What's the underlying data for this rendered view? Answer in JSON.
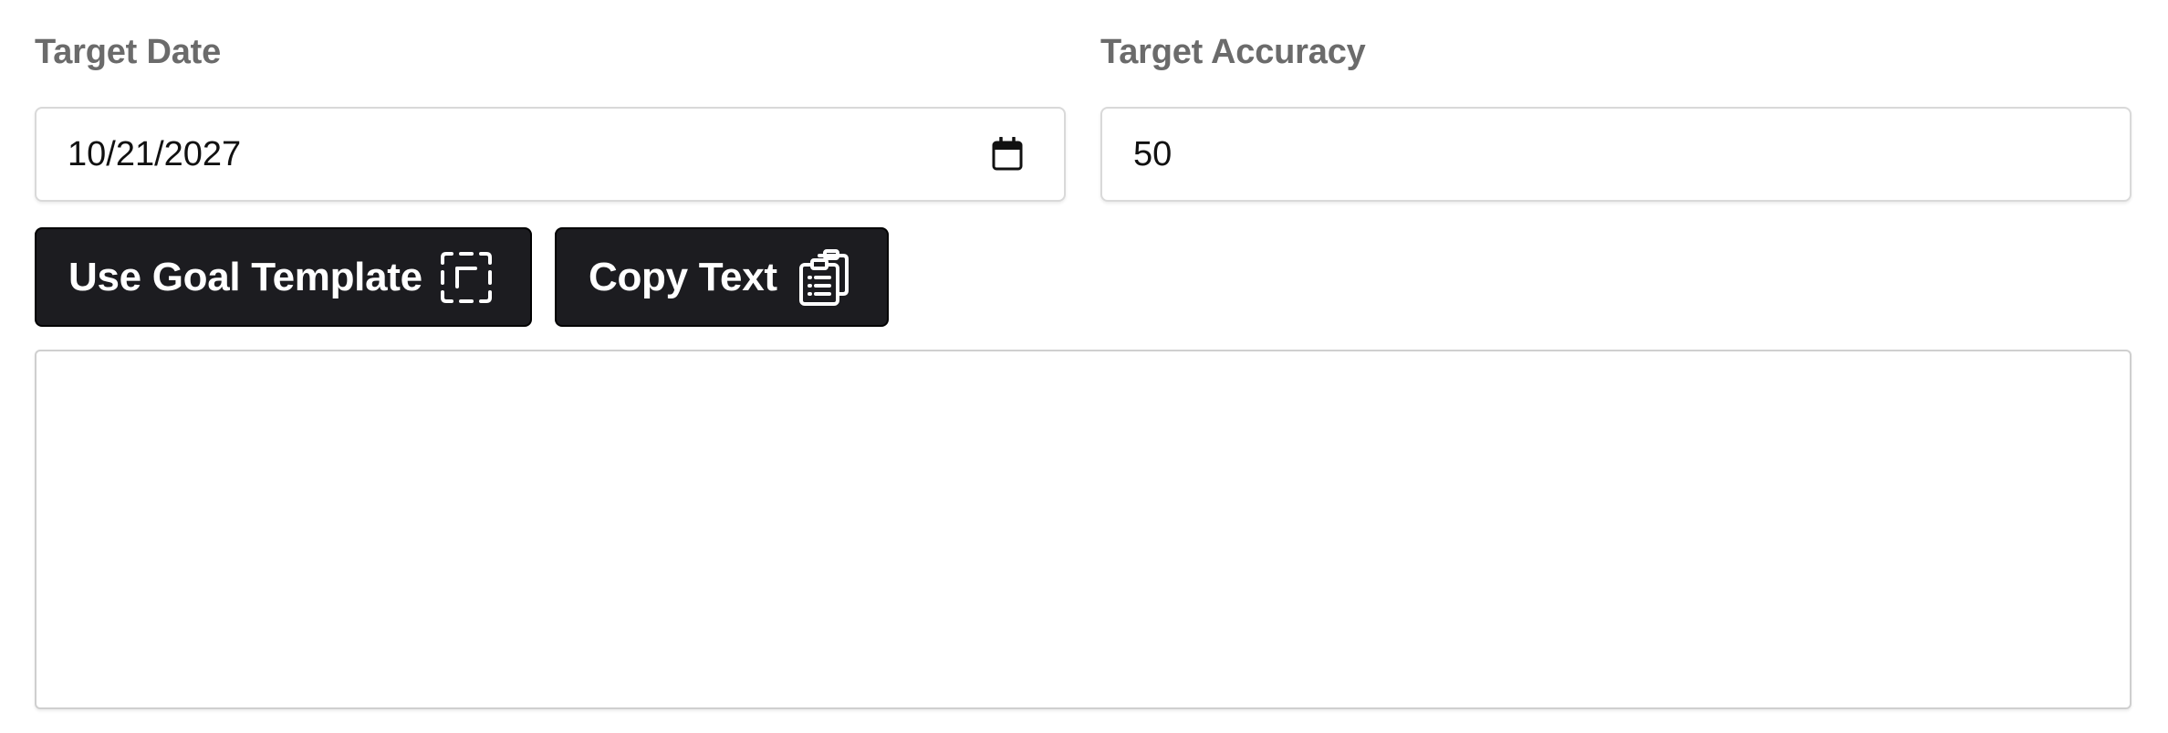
{
  "form": {
    "target_date": {
      "label": "Target Date",
      "value": "10/21/2027",
      "icon": "calendar-icon"
    },
    "target_accuracy": {
      "label": "Target Accuracy",
      "value": "50"
    }
  },
  "actions": {
    "use_goal_template": {
      "label": "Use Goal Template",
      "icon": "dashed-square-icon"
    },
    "copy_text": {
      "label": "Copy Text",
      "icon": "clipboard-copy-icon"
    }
  },
  "goal_text": {
    "value": ""
  },
  "colors": {
    "button_bg": "#1c1c20",
    "button_text": "#ffffff",
    "label_text": "#6b6b6b",
    "field_border": "#d9d9d9"
  }
}
